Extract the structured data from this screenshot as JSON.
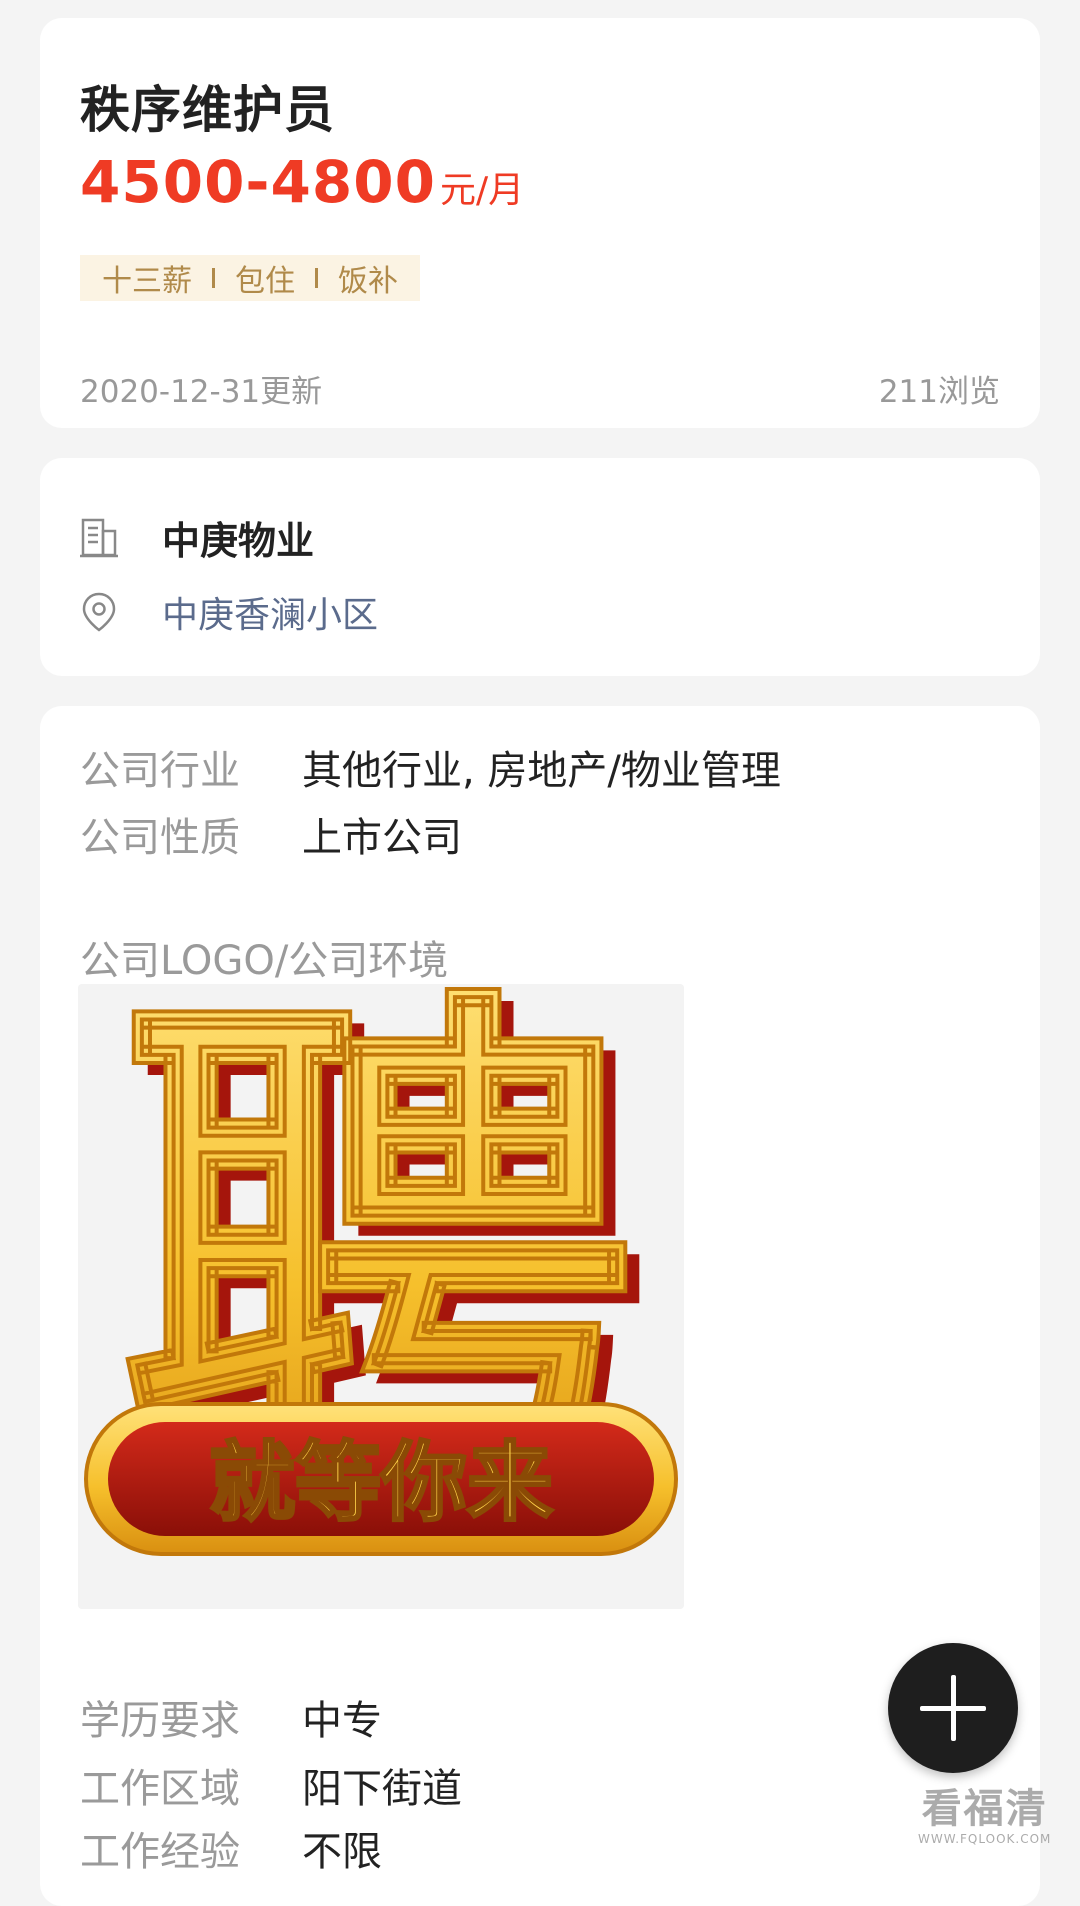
{
  "job": {
    "title": "秩序维护员",
    "salary_amount": "4500-4800",
    "salary_unit": "元/月",
    "benefits": [
      "十三薪",
      "包住",
      "饭补"
    ],
    "updated": "2020-12-31更新",
    "views": "211浏览"
  },
  "company": {
    "name": "中庚物业",
    "location": "中庚香澜小区",
    "icons": {
      "company": "building-icon",
      "location": "location-pin-icon"
    }
  },
  "details": {
    "industry_label": "公司行业",
    "industry_value": "其他行业, 房地产/物业管理",
    "nature_label": "公司性质",
    "nature_value": "上市公司",
    "logo_label": "公司LOGO/公司环境",
    "logo_image": {
      "big_char": "聘",
      "slogan": "就等你来"
    },
    "education_label": "学历要求",
    "education_value": "中专",
    "area_label": "工作区域",
    "area_value": "阳下街道",
    "experience_label": "工作经验",
    "experience_value": "不限"
  },
  "fab": {
    "icon": "plus-icon"
  },
  "watermark": {
    "main": "看福清",
    "sub": "WWW.FQLOOK.COM"
  },
  "colors": {
    "salary": "#ef3b24",
    "benefit_bg": "#fbf3e3",
    "benefit_text": "#b08a4a",
    "link": "#5b6b8c"
  }
}
